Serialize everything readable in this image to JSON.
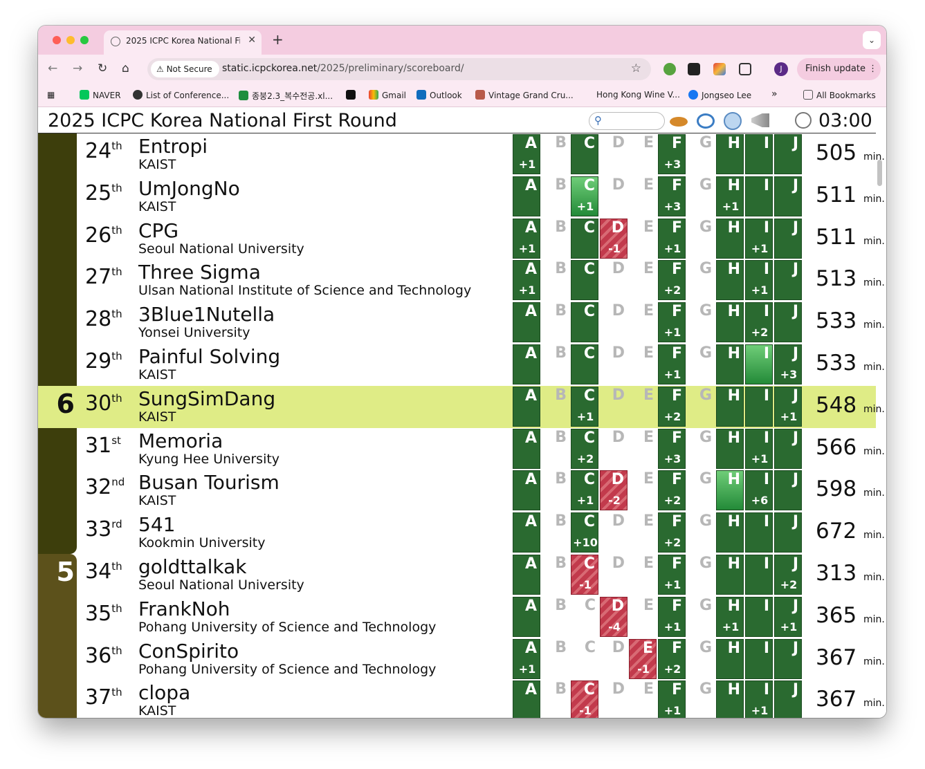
{
  "browser": {
    "tab_title": "2025 ICPC Korea National First Round",
    "address_security": "Not Secure",
    "url_host": "static.icpckorea.net",
    "url_path": "/2025/preliminary/scoreboard/",
    "profile_initial": "J",
    "update_button": "Finish update"
  },
  "bookmarks": [
    "NAVER",
    "List of Conference...",
    "종붕2.3_복수전공.xl...",
    "Gmail",
    "Outlook",
    "Vintage Grand Cru...",
    "Hong Kong Wine V...",
    "Jongseo Lee"
  ],
  "bookmarks_more": "»",
  "bookmarks_all": "All Bookmarks",
  "scoreboard": {
    "title": "2025 ICPC Korea National First Round",
    "timer": "03:00",
    "min_label": "min.",
    "problem_letters": [
      "A",
      "B",
      "C",
      "D",
      "E",
      "F",
      "G",
      "H",
      "I",
      "J"
    ],
    "rows": [
      {
        "rank": "24",
        "suffix": "th",
        "team": "Entropi",
        "university": "KAIST",
        "score": "505",
        "solved": "",
        "group": "6",
        "highlight": false,
        "results": [
          "s+1",
          "",
          "s",
          "",
          "",
          "s+3",
          "",
          "s",
          "s",
          "s"
        ]
      },
      {
        "rank": "25",
        "suffix": "th",
        "team": "UmJongNo",
        "university": "KAIST",
        "score": "511",
        "solved": "",
        "group": "6",
        "highlight": false,
        "results": [
          "s",
          "",
          "f+1",
          "",
          "",
          "s+3",
          "",
          "s+1",
          "s",
          "s"
        ]
      },
      {
        "rank": "26",
        "suffix": "th",
        "team": "CPG",
        "university": "Seoul National University",
        "score": "511",
        "solved": "",
        "group": "6",
        "highlight": false,
        "results": [
          "s+1",
          "",
          "s",
          "w-1",
          "",
          "s+1",
          "",
          "s",
          "s+1",
          "s"
        ]
      },
      {
        "rank": "27",
        "suffix": "th",
        "team": "Three Sigma",
        "university": "Ulsan National Institute of Science and Technology",
        "score": "513",
        "solved": "",
        "group": "6",
        "highlight": false,
        "results": [
          "s+1",
          "",
          "s",
          "",
          "",
          "s+2",
          "",
          "s",
          "s+1",
          "s"
        ]
      },
      {
        "rank": "28",
        "suffix": "th",
        "team": "3Blue1Nutella",
        "university": "Yonsei University",
        "score": "533",
        "solved": "",
        "group": "6",
        "highlight": false,
        "results": [
          "s",
          "",
          "s",
          "",
          "",
          "s+1",
          "",
          "s",
          "s+2",
          "s"
        ]
      },
      {
        "rank": "29",
        "suffix": "th",
        "team": "Painful Solving",
        "university": "KAIST",
        "score": "533",
        "solved": "",
        "group": "6",
        "highlight": false,
        "results": [
          "s",
          "",
          "s",
          "",
          "",
          "s+1",
          "",
          "s",
          "f",
          "s+3"
        ]
      },
      {
        "rank": "30",
        "suffix": "th",
        "team": "SungSimDang",
        "university": "KAIST",
        "score": "548",
        "solved": "6",
        "group": "6",
        "highlight": true,
        "results": [
          "s",
          "",
          "s+1",
          "",
          "",
          "s+2",
          "",
          "s",
          "s",
          "s+1"
        ]
      },
      {
        "rank": "31",
        "suffix": "st",
        "team": "Memoria",
        "university": "Kyung Hee University",
        "score": "566",
        "solved": "",
        "group": "6",
        "highlight": false,
        "results": [
          "s",
          "",
          "s+2",
          "",
          "",
          "s+3",
          "",
          "s",
          "s+1",
          "s"
        ]
      },
      {
        "rank": "32",
        "suffix": "nd",
        "team": "Busan Tourism",
        "university": "KAIST",
        "score": "598",
        "solved": "",
        "group": "6",
        "highlight": false,
        "results": [
          "s",
          "",
          "s+1",
          "w-2",
          "",
          "s+2",
          "",
          "f",
          "s+6",
          "s"
        ]
      },
      {
        "rank": "33",
        "suffix": "rd",
        "team": "541",
        "university": "Kookmin University",
        "score": "672",
        "solved": "",
        "group": "6",
        "highlight": false,
        "results": [
          "s",
          "",
          "s+10",
          "",
          "",
          "s+2",
          "",
          "s",
          "s",
          "s"
        ]
      },
      {
        "rank": "34",
        "suffix": "th",
        "team": "goldttalkak",
        "university": "Seoul National University",
        "score": "313",
        "solved": "5",
        "group": "5",
        "highlight": false,
        "results": [
          "s",
          "",
          "w-1",
          "",
          "",
          "s+1",
          "",
          "s",
          "s",
          "s+2"
        ]
      },
      {
        "rank": "35",
        "suffix": "th",
        "team": "FrankNoh",
        "university": "Pohang University of Science and Technology",
        "score": "365",
        "solved": "",
        "group": "5",
        "highlight": false,
        "results": [
          "s",
          "",
          "",
          "w-4",
          "",
          "s+1",
          "",
          "s+1",
          "s",
          "s+1"
        ]
      },
      {
        "rank": "36",
        "suffix": "th",
        "team": "ConSpirito",
        "university": "Pohang University of Science and Technology",
        "score": "367",
        "solved": "",
        "group": "5",
        "highlight": false,
        "results": [
          "s+1",
          "",
          "",
          "",
          "w-1",
          "s+2",
          "",
          "s",
          "s",
          "s"
        ]
      },
      {
        "rank": "37",
        "suffix": "th",
        "team": "clopa",
        "university": "KAIST",
        "score": "367",
        "solved": "",
        "group": "5",
        "highlight": false,
        "results": [
          "s",
          "",
          "w-1",
          "",
          "",
          "s+1",
          "",
          "s",
          "s+1",
          "s"
        ]
      }
    ]
  },
  "colors": {
    "solved": "#2a6a30",
    "first_solve": "#4cb05a",
    "wrong": "#c23a4c",
    "highlight_row": "#dfec86",
    "group6_band": "#3d3e0c",
    "group5_band": "#5c511b"
  }
}
